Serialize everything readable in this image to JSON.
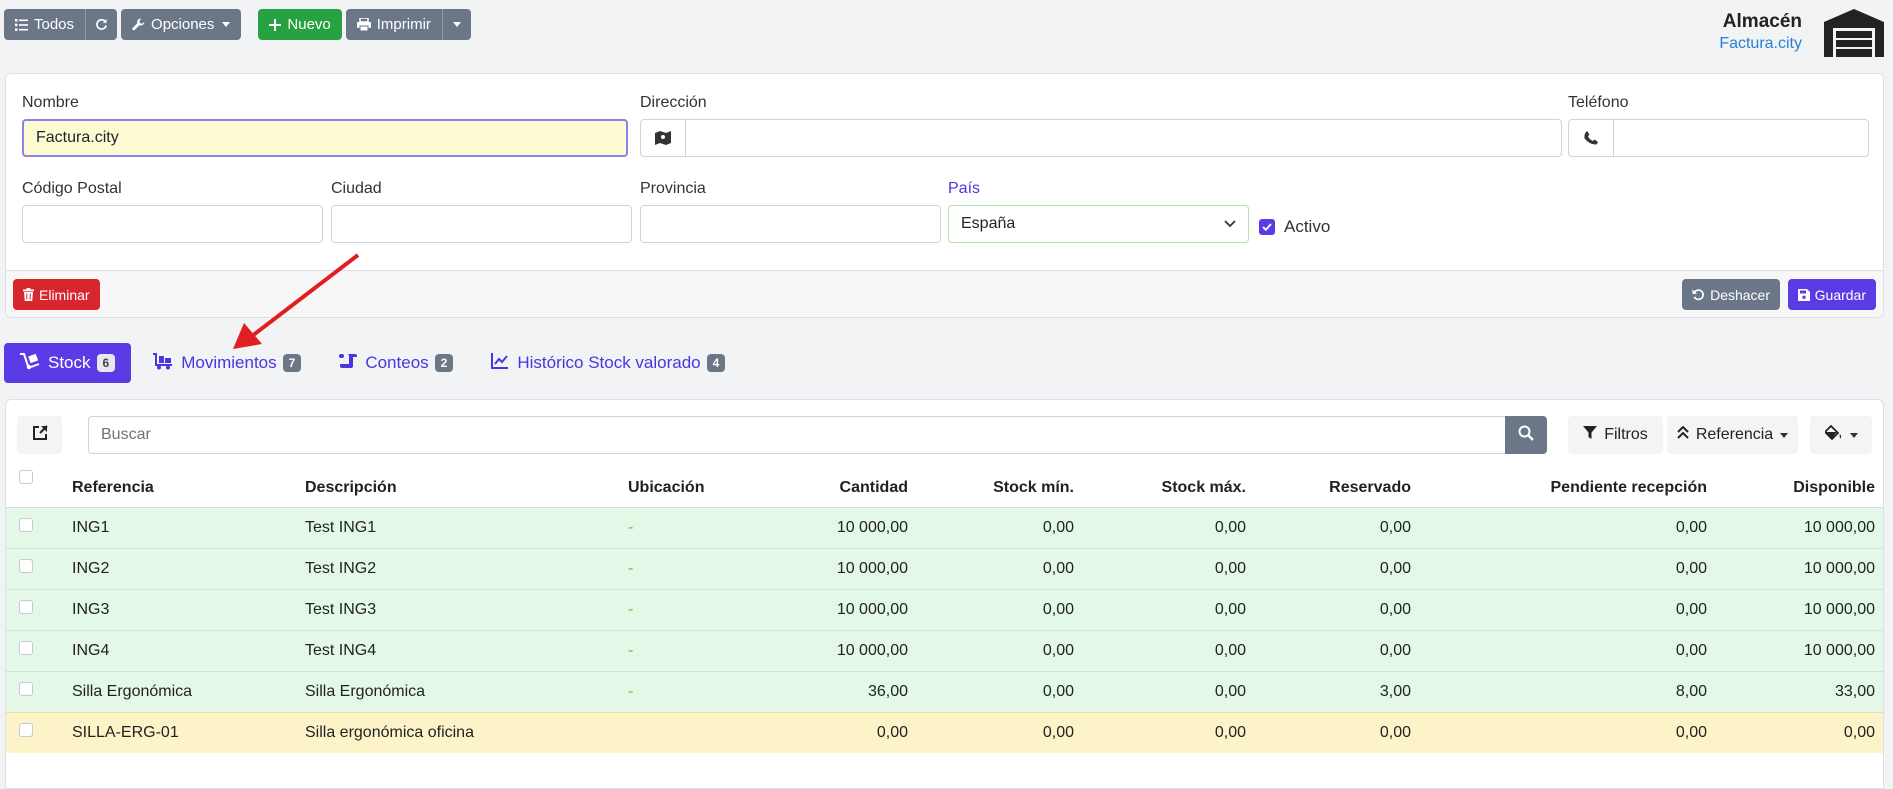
{
  "toolbar": {
    "all_label": "Todos",
    "options_label": "Opciones",
    "new_label": "Nuevo",
    "print_label": "Imprimir"
  },
  "header": {
    "title": "Almacén",
    "subtitle": "Factura.city"
  },
  "form": {
    "name_label": "Nombre",
    "name_value": "Factura.city",
    "address_label": "Dirección",
    "address_value": "",
    "phone_label": "Teléfono",
    "phone_value": "",
    "postal_label": "Código Postal",
    "postal_value": "",
    "city_label": "Ciudad",
    "city_value": "",
    "province_label": "Provincia",
    "province_value": "",
    "country_label": "País",
    "country_value": "España",
    "active_label": "Activo",
    "active_checked": true,
    "delete_label": "Eliminar",
    "undo_label": "Deshacer",
    "save_label": "Guardar"
  },
  "tabs": [
    {
      "label": "Stock",
      "count": "6",
      "active": true
    },
    {
      "label": "Movimientos",
      "count": "7",
      "active": false
    },
    {
      "label": "Conteos",
      "count": "2",
      "active": false
    },
    {
      "label": "Histórico Stock valorado",
      "count": "4",
      "active": false
    }
  ],
  "list": {
    "search_placeholder": "Buscar",
    "filters_label": "Filtros",
    "order_label": "Referencia",
    "columns": [
      "Referencia",
      "Descripción",
      "Ubicación",
      "Cantidad",
      "Stock mín.",
      "Stock máx.",
      "Reservado",
      "Pendiente recepción",
      "Disponible"
    ],
    "rows": [
      {
        "ref": "ING1",
        "desc": "Test ING1",
        "loc": "-",
        "qty": "10 000,00",
        "min": "0,00",
        "max": "0,00",
        "reserved": "0,00",
        "pending": "0,00",
        "available": "10 000,00",
        "status": "green"
      },
      {
        "ref": "ING2",
        "desc": "Test ING2",
        "loc": "-",
        "qty": "10 000,00",
        "min": "0,00",
        "max": "0,00",
        "reserved": "0,00",
        "pending": "0,00",
        "available": "10 000,00",
        "status": "green"
      },
      {
        "ref": "ING3",
        "desc": "Test ING3",
        "loc": "-",
        "qty": "10 000,00",
        "min": "0,00",
        "max": "0,00",
        "reserved": "0,00",
        "pending": "0,00",
        "available": "10 000,00",
        "status": "green"
      },
      {
        "ref": "ING4",
        "desc": "Test ING4",
        "loc": "-",
        "qty": "10 000,00",
        "min": "0,00",
        "max": "0,00",
        "reserved": "0,00",
        "pending": "0,00",
        "available": "10 000,00",
        "status": "green"
      },
      {
        "ref": "Silla Ergonómica",
        "desc": "Silla Ergonómica",
        "loc": "-",
        "qty": "36,00",
        "min": "0,00",
        "max": "0,00",
        "reserved": "3,00",
        "pending": "8,00",
        "available": "33,00",
        "status": "green"
      },
      {
        "ref": "SILLA-ERG-01",
        "desc": "Silla ergonómica oficina",
        "loc": "",
        "qty": "0,00",
        "min": "0,00",
        "max": "0,00",
        "reserved": "0,00",
        "pending": "0,00",
        "available": "0,00",
        "status": "yellow"
      }
    ]
  },
  "colors": {
    "primary": "#5b3be6",
    "success": "#27a243",
    "danger": "#d8262f",
    "secondary": "#6b7687",
    "row_ok": "#e3f8e7",
    "row_warn": "#fdf3c9",
    "annotation_arrow": "#e02020"
  }
}
